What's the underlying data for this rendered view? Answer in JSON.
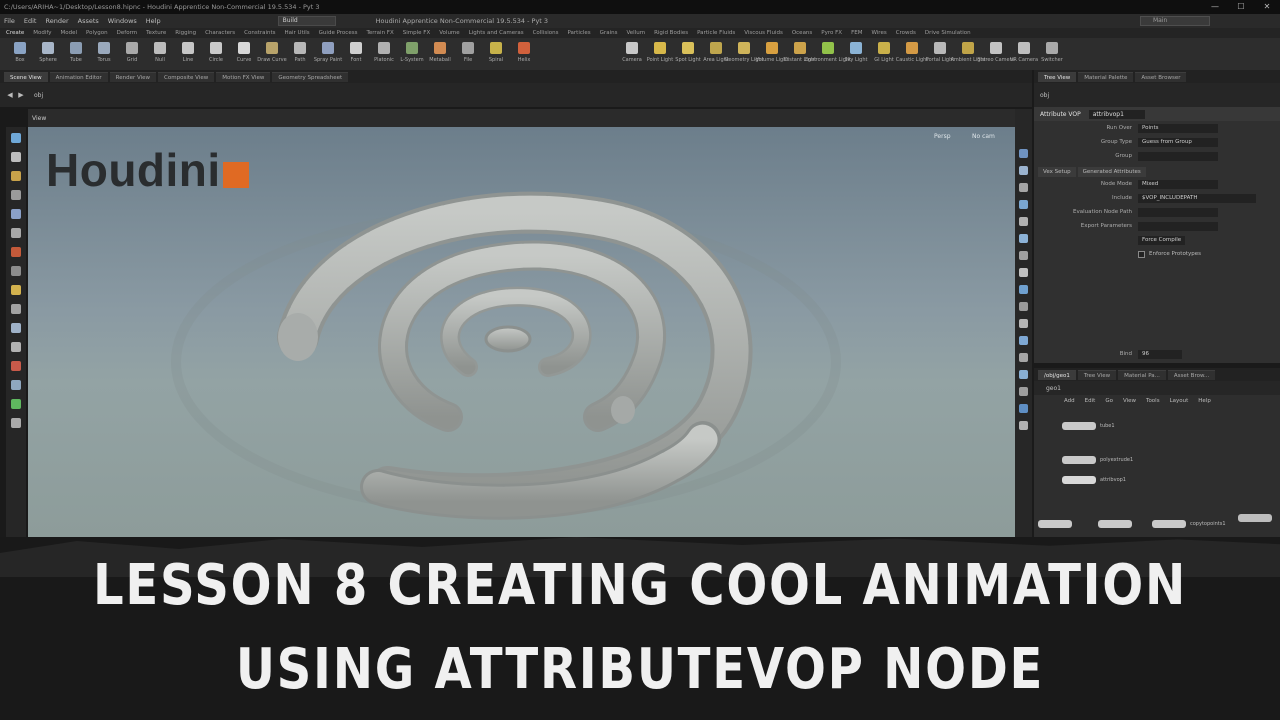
{
  "window": {
    "title_path": "C:/Users/ARIHA~1/Desktop/Lesson8.hipnc - Houdini Apprentice Non-Commercial 19.5.534 - Pyt 3",
    "buttons": [
      "—",
      "☐",
      "✕"
    ]
  },
  "menubar": {
    "items": [
      "File",
      "Edit",
      "Render",
      "Assets",
      "Windows",
      "Help"
    ],
    "desktop": "Build",
    "app_title": "Houdini Apprentice Non-Commercial 19.5.534 - Pyt 3",
    "search_placeholder": "Main"
  },
  "shelf": {
    "tabs": [
      "Create",
      "Modify",
      "Model",
      "Polygon",
      "Deform",
      "Texture",
      "Rigging",
      "Characters",
      "Constraints",
      "Hair Utils",
      "Guide Process",
      "Terrain FX",
      "Simple FX",
      "Volume",
      "Lights and Cameras",
      "Collisions",
      "Particles",
      "Grains",
      "Vellum",
      "Rigid Bodies",
      "Particle Fluids",
      "Viscous Fluids",
      "Oceans",
      "Pyro FX",
      "FEM",
      "Wires",
      "Crowds",
      "Drive Simulation"
    ],
    "tools": [
      {
        "label": "Box",
        "color": "#8aa3c4"
      },
      {
        "label": "Sphere",
        "color": "#a8b6c8"
      },
      {
        "label": "Tube",
        "color": "#8b9db3"
      },
      {
        "label": "Torus",
        "color": "#9aa9bc"
      },
      {
        "label": "Grid",
        "color": "#a9a9a9"
      },
      {
        "label": "Null",
        "color": "#bdbdbd"
      },
      {
        "label": "Line",
        "color": "#c6c6c6"
      },
      {
        "label": "Circle",
        "color": "#c9c9c9"
      },
      {
        "label": "Curve",
        "color": "#d8d8d8"
      },
      {
        "label": "Draw Curve",
        "color": "#b8a36a"
      },
      {
        "label": "Path",
        "color": "#b7b7b7"
      },
      {
        "label": "Spray Paint",
        "color": "#8f9fbf"
      },
      {
        "label": "Font",
        "color": "#d0d0d0"
      },
      {
        "label": "Platonic",
        "color": "#b0b0b0"
      },
      {
        "label": "L-System",
        "color": "#7fa06a"
      },
      {
        "label": "Metaball",
        "color": "#d28b52"
      },
      {
        "label": "File",
        "color": "#a0a0a0"
      },
      {
        "label": "Spiral",
        "color": "#c7b24a"
      },
      {
        "label": "Helix",
        "color": "#d2613c"
      }
    ],
    "light_tools": [
      {
        "label": "Camera",
        "color": "#c8c8c8"
      },
      {
        "label": "Point Light",
        "color": "#d7b84a"
      },
      {
        "label": "Spot Light",
        "color": "#d9c05a"
      },
      {
        "label": "Area Light",
        "color": "#bfa64d"
      },
      {
        "label": "Geometry Light",
        "color": "#cfb45a"
      },
      {
        "label": "Volume Light",
        "color": "#d8a040"
      },
      {
        "label": "Distant Light",
        "color": "#cda34b"
      },
      {
        "label": "Environment Light",
        "color": "#92c24a"
      },
      {
        "label": "Sky Light",
        "color": "#8bb3d5"
      },
      {
        "label": "GI Light",
        "color": "#c9b04a"
      },
      {
        "label": "Caustic Light",
        "color": "#d49a45"
      },
      {
        "label": "Portal Light",
        "color": "#b8b8b8"
      },
      {
        "label": "Ambient Light",
        "color": "#c0a448"
      },
      {
        "label": "Stereo Camera",
        "color": "#c3c3c3"
      },
      {
        "label": "VR Camera",
        "color": "#bfbfbf"
      },
      {
        "label": "Switcher",
        "color": "#a9a9a9"
      }
    ]
  },
  "panes": {
    "left_tabs": [
      "Scene View",
      "Animation Editor",
      "Render View",
      "Composite View",
      "Motion FX View",
      "Geometry Spreadsheet"
    ],
    "left_path": "obj",
    "right_tabs": [
      "Tree View",
      "Material Palette",
      "Asset Browser"
    ],
    "right_path": "obj"
  },
  "viewport": {
    "view_name": "View",
    "persp_label": "Persp",
    "cam_label": "No cam",
    "logo_text": "Houdini"
  },
  "parameters": {
    "node_type": "Attribute VOP",
    "node_name": "attribvop1",
    "rows": [
      {
        "label": "Run Over",
        "value": "Points"
      },
      {
        "label": "Group Type",
        "value": "Guess from Group"
      },
      {
        "label": "Group",
        "value": ""
      },
      {
        "label": "Node Mode",
        "value": "Mixed"
      },
      {
        "label": "Include",
        "value": "$VOP_INCLUDEPATH"
      },
      {
        "label": "Evaluation Node Path",
        "value": ""
      },
      {
        "label": "Export Parameters",
        "value": ""
      }
    ],
    "tabs": [
      "Vex Setup",
      "Generated Attributes"
    ],
    "checkbox_label": "Enforce Prototypes",
    "bind_label": "Force Compile",
    "number_label": "Bind",
    "number_value": "96"
  },
  "network": {
    "tabs": [
      "/obj/geo1",
      "Tree View",
      "Material Pa...",
      "Asset Brow..."
    ],
    "path": "geo1",
    "menu": [
      "Add",
      "Edit",
      "Go",
      "View",
      "Tools",
      "Layout",
      "Help"
    ],
    "nodes": [
      "tube1",
      "polyextrude1",
      "attribvop1",
      "copytopoints1"
    ]
  },
  "banner": {
    "line1": "Lesson 8 creating cool animation",
    "line2": "using attributevop node"
  }
}
